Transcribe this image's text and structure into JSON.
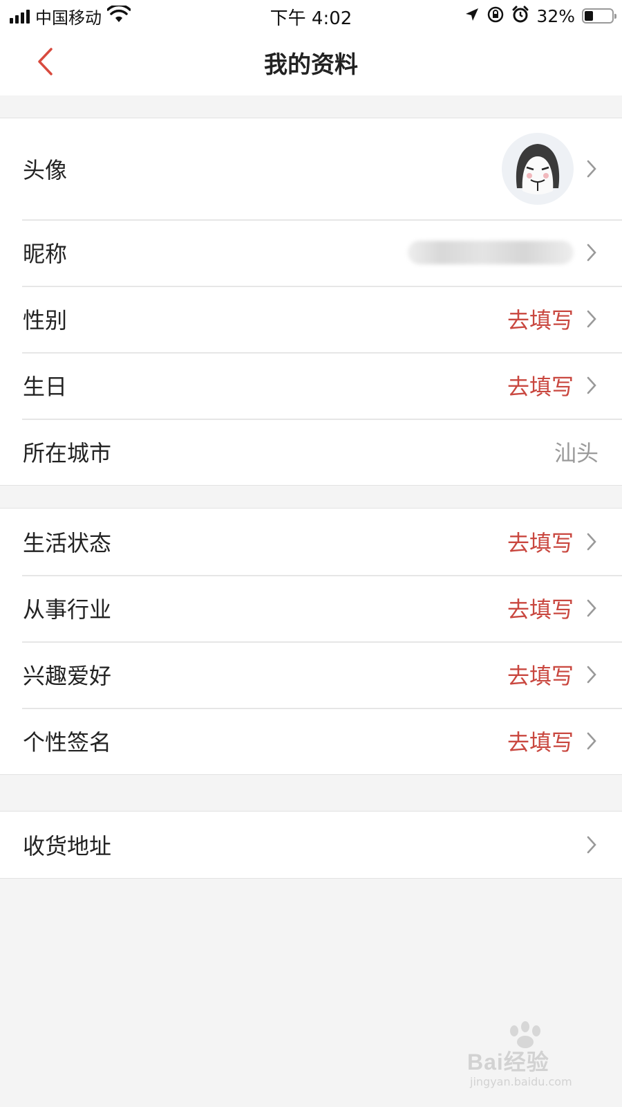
{
  "status_bar": {
    "carrier": "中国移动",
    "time": "下午 4:02",
    "battery_percent": "32%",
    "battery_level": 0.32,
    "icons": [
      "signal-icon",
      "wifi-icon",
      "location-icon",
      "rotation-lock-icon",
      "alarm-icon",
      "battery-icon"
    ]
  },
  "nav": {
    "title": "我的资料",
    "back_icon": "chevron-left-icon"
  },
  "colors": {
    "accent": "#c9473f",
    "secondary_text": "#9a9a9a",
    "background": "#f4f4f4"
  },
  "group1": [
    {
      "label": "头像",
      "type": "avatar"
    },
    {
      "label": "昵称",
      "type": "blurred"
    },
    {
      "label": "性别",
      "value": "去填写"
    },
    {
      "label": "生日",
      "value": "去填写"
    },
    {
      "label": "所在城市",
      "value": "汕头"
    }
  ],
  "group2": [
    {
      "label": "生活状态",
      "value": "去填写"
    },
    {
      "label": "从事行业",
      "value": "去填写"
    },
    {
      "label": "兴趣爱好",
      "value": "去填写"
    },
    {
      "label": "个性签名",
      "value": "去填写"
    }
  ],
  "group3": [
    {
      "label": "收货地址"
    }
  ],
  "watermark": {
    "brand": "Bai经验",
    "url": "jingyan.baidu.com"
  }
}
